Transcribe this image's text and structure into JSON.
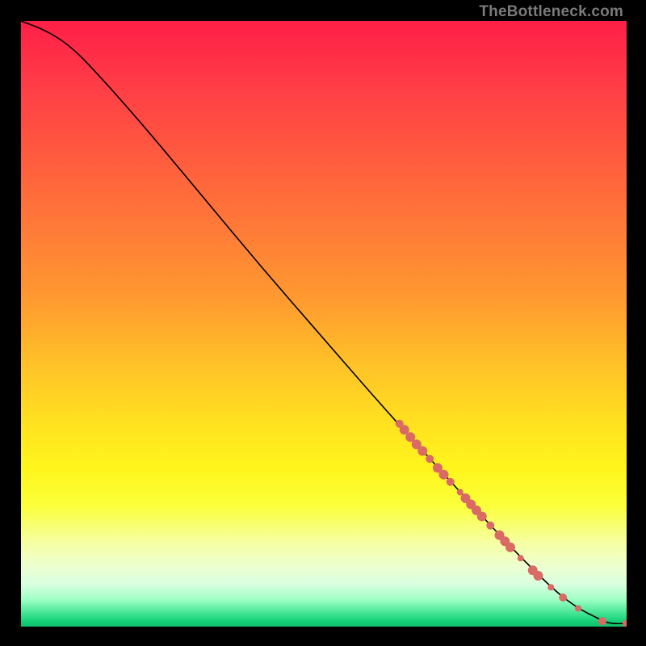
{
  "watermark": "TheBottleneck.com",
  "colors": {
    "curve": "#000000",
    "dots": "#d96a64",
    "background_top": "#ff1f47",
    "background_bottom": "#0fbf6d"
  },
  "chart_data": {
    "type": "line",
    "title": "",
    "xlabel": "",
    "ylabel": "",
    "xlim": [
      0,
      100
    ],
    "ylim": [
      0,
      100
    ],
    "grid": false,
    "series": [
      {
        "name": "curve",
        "x": [
          0,
          4,
          8,
          12,
          20,
          30,
          40,
          50,
          60,
          70,
          80,
          88,
          92,
          95,
          97,
          100
        ],
        "y": [
          100,
          98.5,
          96,
          92,
          83,
          71,
          59,
          47.5,
          36,
          25,
          14,
          6,
          3,
          1.5,
          0.5,
          0.5
        ]
      }
    ],
    "scatter_points": [
      {
        "x": 62.5,
        "y": 33.5,
        "r": 5
      },
      {
        "x": 63.3,
        "y": 32.5,
        "r": 6
      },
      {
        "x": 64.3,
        "y": 31.3,
        "r": 6
      },
      {
        "x": 65.3,
        "y": 30.1,
        "r": 6
      },
      {
        "x": 66.3,
        "y": 29.0,
        "r": 6
      },
      {
        "x": 67.5,
        "y": 27.7,
        "r": 5
      },
      {
        "x": 68.8,
        "y": 26.2,
        "r": 6
      },
      {
        "x": 69.8,
        "y": 25.1,
        "r": 6
      },
      {
        "x": 70.9,
        "y": 23.9,
        "r": 5
      },
      {
        "x": 72.5,
        "y": 22.2,
        "r": 4
      },
      {
        "x": 73.4,
        "y": 21.2,
        "r": 6
      },
      {
        "x": 74.3,
        "y": 20.2,
        "r": 6
      },
      {
        "x": 75.2,
        "y": 19.2,
        "r": 6
      },
      {
        "x": 76.1,
        "y": 18.2,
        "r": 6
      },
      {
        "x": 77.5,
        "y": 16.7,
        "r": 5
      },
      {
        "x": 79.0,
        "y": 15.1,
        "r": 6
      },
      {
        "x": 79.9,
        "y": 14.1,
        "r": 6
      },
      {
        "x": 80.8,
        "y": 13.1,
        "r": 6
      },
      {
        "x": 82.5,
        "y": 11.3,
        "r": 4
      },
      {
        "x": 84.5,
        "y": 9.3,
        "r": 6
      },
      {
        "x": 85.4,
        "y": 8.4,
        "r": 6
      },
      {
        "x": 87.5,
        "y": 6.5,
        "r": 4
      },
      {
        "x": 89.5,
        "y": 4.8,
        "r": 5
      },
      {
        "x": 92.0,
        "y": 3.0,
        "r": 4
      },
      {
        "x": 96.0,
        "y": 0.9,
        "r": 5
      },
      {
        "x": 100.0,
        "y": 0.5,
        "r": 5
      }
    ]
  }
}
